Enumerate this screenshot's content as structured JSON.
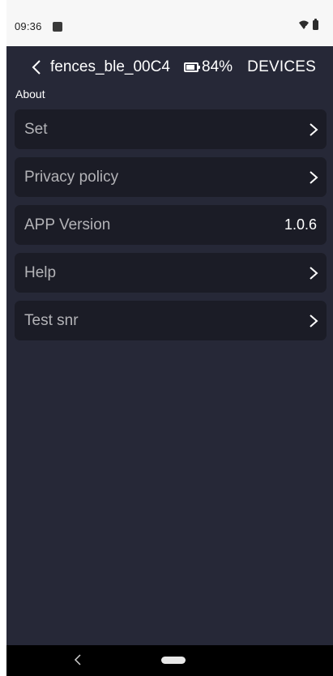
{
  "status_bar": {
    "time": "09:36",
    "icons": [
      "app-notification-icon",
      "wifi-icon",
      "battery-icon"
    ]
  },
  "header": {
    "device_name": "fences_ble_00C4",
    "battery_percent": "84%",
    "battery_level": 0.84,
    "devices_label": "DEVICES"
  },
  "section": {
    "title": "About"
  },
  "menu": {
    "items": [
      {
        "label": "Set",
        "icon": "chevron-right-icon"
      },
      {
        "label": "Privacy policy",
        "icon": "chevron-right-icon"
      },
      {
        "label": "APP Version",
        "value": "1.0.6"
      },
      {
        "label": "Help",
        "icon": "chevron-right-icon"
      },
      {
        "label": "Test snr",
        "icon": "chevron-right-icon"
      }
    ]
  },
  "colors": {
    "background": "#262837",
    "row_background": "#1b1c26",
    "status_bar": "#f7f7f7",
    "text_primary": "#ffffff",
    "text_muted": "#b3b3b7"
  }
}
